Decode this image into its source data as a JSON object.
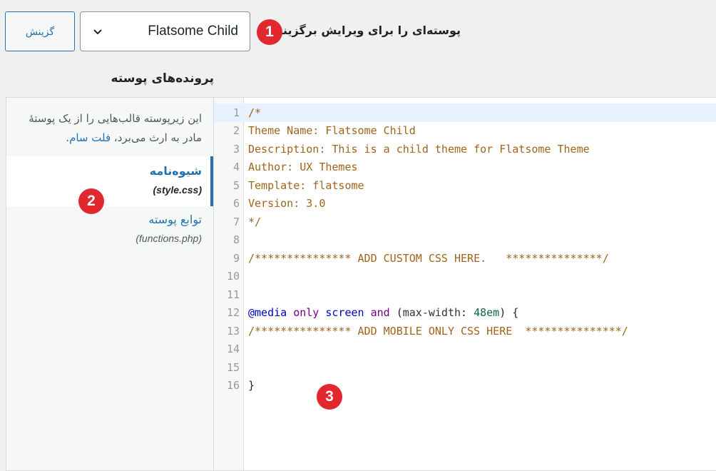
{
  "toolbar": {
    "select_button_label": "گزینش",
    "theme_select_value": "Flatsome Child",
    "choose_label": "پوسته‌ای را برای ویرایش برگزینید:"
  },
  "badges": [
    "1",
    "2",
    "3"
  ],
  "files_heading": "پرونده‌های پوسته",
  "sidebar": {
    "description_prefix": "این زیرپوسته قالب‌هایی را از یک پوستهٔ مادر به ارث می‌برد،",
    "parent_theme_link": "فلت سام",
    "description_suffix": ".",
    "files": [
      {
        "title": "شیوه‌نامه",
        "filename": "(style.css)",
        "active": true
      },
      {
        "title": "توابع پوسته",
        "filename": "(functions.php)",
        "active": false
      }
    ]
  },
  "editor": {
    "lines": [
      {
        "n": "1",
        "tokens": [
          {
            "t": "/*",
            "c": "c-comment"
          }
        ]
      },
      {
        "n": "2",
        "tokens": [
          {
            "t": "Theme Name: Flatsome Child",
            "c": "c-comment"
          }
        ]
      },
      {
        "n": "3",
        "tokens": [
          {
            "t": "Description: This is a child theme for Flatsome Theme",
            "c": "c-comment"
          }
        ]
      },
      {
        "n": "4",
        "tokens": [
          {
            "t": "Author: UX Themes",
            "c": "c-comment"
          }
        ]
      },
      {
        "n": "5",
        "tokens": [
          {
            "t": "Template: flatsome",
            "c": "c-comment"
          }
        ]
      },
      {
        "n": "6",
        "tokens": [
          {
            "t": "Version: 3.0",
            "c": "c-comment"
          }
        ]
      },
      {
        "n": "7",
        "tokens": [
          {
            "t": "*/",
            "c": "c-comment"
          }
        ]
      },
      {
        "n": "8",
        "tokens": []
      },
      {
        "n": "9",
        "tokens": [
          {
            "t": "/*************** ADD CUSTOM CSS HERE.   ***************/",
            "c": "c-comment"
          }
        ]
      },
      {
        "n": "10",
        "tokens": []
      },
      {
        "n": "11",
        "tokens": []
      },
      {
        "n": "12",
        "tokens": [
          {
            "t": "@media",
            "c": "c-def"
          },
          {
            "t": " ",
            "c": "c-plain"
          },
          {
            "t": "only",
            "c": "c-kw"
          },
          {
            "t": " ",
            "c": "c-plain"
          },
          {
            "t": "screen",
            "c": "c-def"
          },
          {
            "t": " ",
            "c": "c-plain"
          },
          {
            "t": "and",
            "c": "c-kw"
          },
          {
            "t": " (",
            "c": "c-plain"
          },
          {
            "t": "max-width",
            "c": "c-var"
          },
          {
            "t": ": ",
            "c": "c-plain"
          },
          {
            "t": "48em",
            "c": "c-num"
          },
          {
            "t": ") {",
            "c": "c-plain"
          }
        ]
      },
      {
        "n": "13",
        "tokens": [
          {
            "t": "/*************** ADD MOBILE ONLY CSS HERE  ***************/",
            "c": "c-comment"
          }
        ]
      },
      {
        "n": "14",
        "tokens": []
      },
      {
        "n": "15",
        "tokens": []
      },
      {
        "n": "16",
        "tokens": [
          {
            "t": "}",
            "c": "c-plain"
          }
        ]
      }
    ]
  }
}
